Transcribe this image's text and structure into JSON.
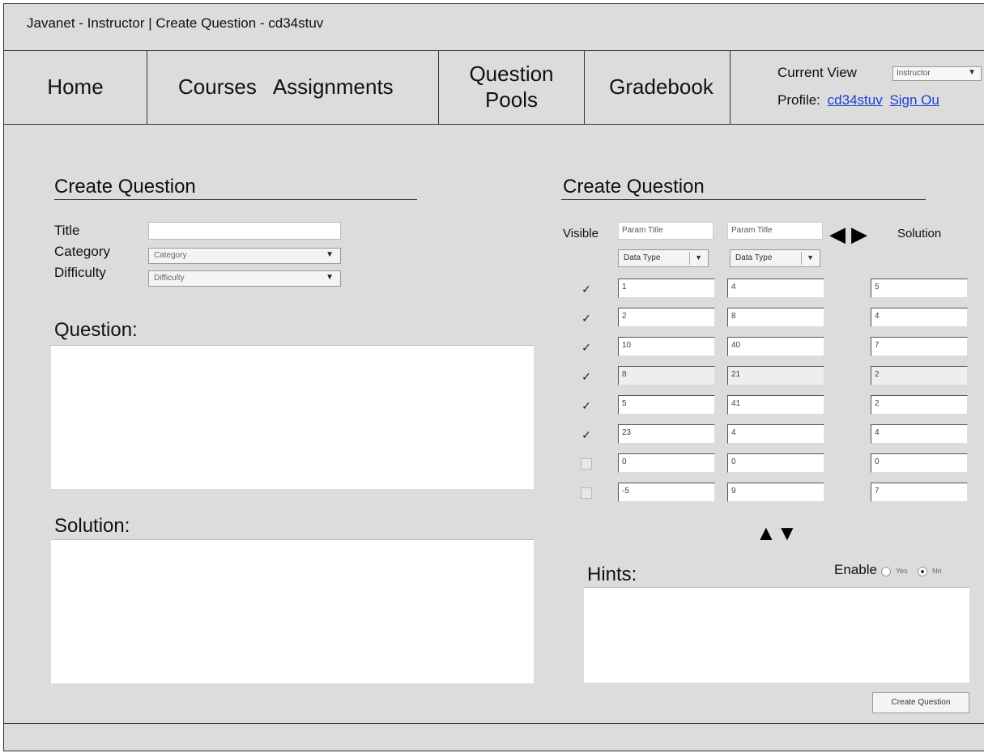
{
  "window_title": "Javanet - Instructor | Create Question - cd34stuv",
  "nav": {
    "home": "Home",
    "courses": "Courses",
    "assignments": "Assignments",
    "question_pools_1": "Question",
    "question_pools_2": "Pools",
    "gradebook": "Gradebook"
  },
  "header": {
    "current_view_label": "Current View",
    "current_view_value": "Instructor",
    "profile_label": "Profile:",
    "profile_user": "cd34stuv",
    "sign_out": "Sign Ou"
  },
  "left": {
    "section_title": "Create Question",
    "title_label": "Title",
    "category_label": "Category",
    "category_value": "Category",
    "difficulty_label": "Difficulty",
    "difficulty_value": "Difficulty",
    "question_label": "Question:",
    "solution_label": "Solution:"
  },
  "right": {
    "section_title": "Create Question",
    "visible_label": "Visible",
    "param1_title": "Param Title",
    "param2_title": "Param Title",
    "solution_label": "Solution",
    "data_type_1": "Data Type",
    "data_type_2": "Data Type",
    "rows": [
      {
        "checked": true,
        "a": "1",
        "b": "4",
        "s": "5"
      },
      {
        "checked": true,
        "a": "2",
        "b": "8",
        "s": "4"
      },
      {
        "checked": true,
        "a": "10",
        "b": "40",
        "s": "7"
      },
      {
        "checked": true,
        "a": "8",
        "b": "21",
        "s": "2"
      },
      {
        "checked": true,
        "a": "5",
        "b": "41",
        "s": "2"
      },
      {
        "checked": true,
        "a": "23",
        "b": "4",
        "s": "4"
      },
      {
        "checked": false,
        "a": "0",
        "b": "0",
        "s": "0"
      },
      {
        "checked": false,
        "a": "-5",
        "b": "9",
        "s": "7"
      }
    ],
    "hints_label": "Hints:",
    "enable_label": "Enable",
    "yes_label": "Yes",
    "no_label": "No",
    "enable_selected": "No",
    "create_button": "Create Question"
  },
  "icons": {
    "check": "✓",
    "arrow_left": "◀",
    "arrow_right": "▶",
    "arrow_up": "▲",
    "arrow_down": "▼",
    "dropdown": "▼"
  }
}
